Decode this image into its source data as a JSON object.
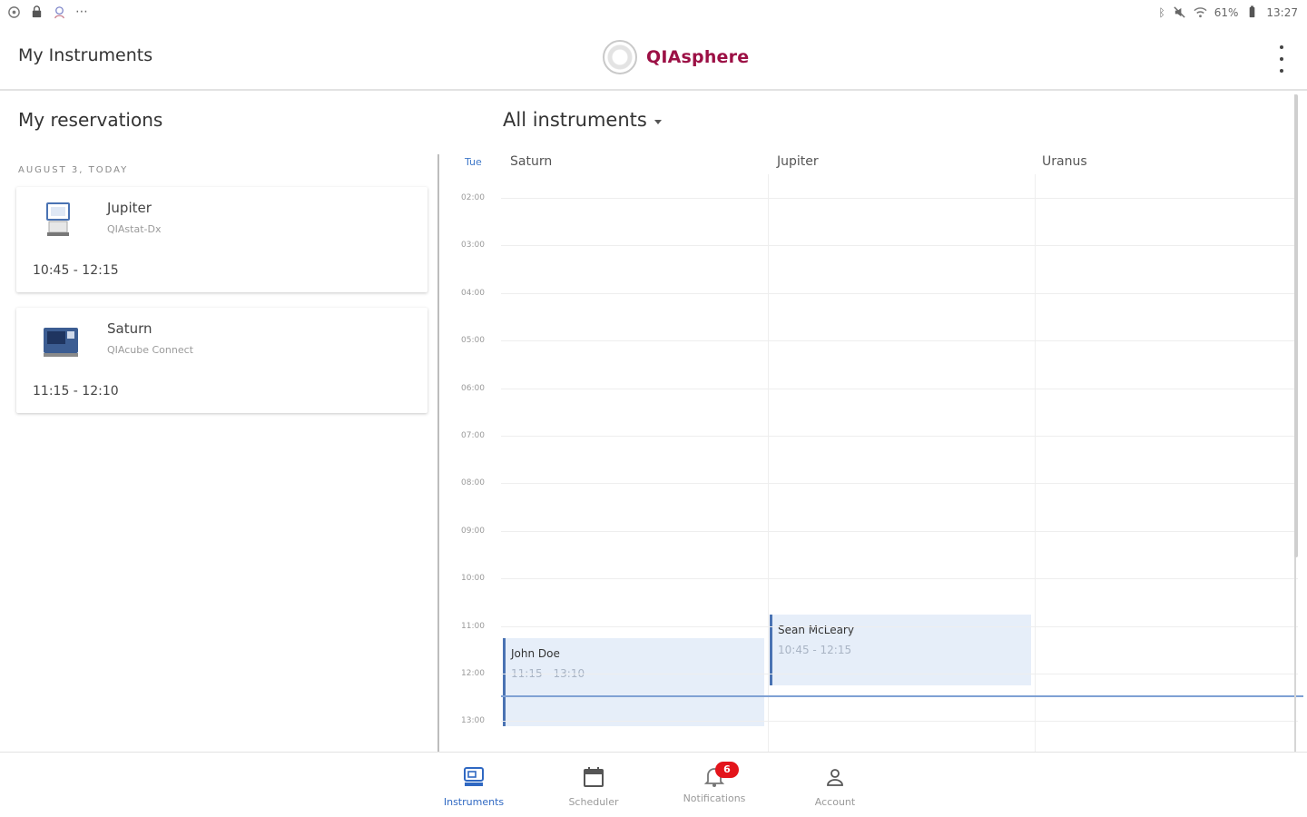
{
  "status_bar": {
    "left_icons": [
      "settings-circle-icon",
      "bag-icon",
      "account-circle-icon",
      "more-dots-icon"
    ],
    "right": {
      "battery_pct": "61%",
      "time": "13:27"
    },
    "right_icons": [
      "bluetooth-icon",
      "mute-icon",
      "wifi-icon",
      "battery-icon"
    ]
  },
  "app_bar": {
    "title": "My Instruments",
    "brand_name": "QIAsphere",
    "colors": {
      "brand": "#9c1045"
    }
  },
  "left_panel": {
    "title": "My reservations",
    "date_caption": "AUGUST 3, TODAY",
    "reservations": [
      {
        "name": "Jupiter",
        "model": "QIAstat-Dx",
        "time": "10:45 - 12:15",
        "icon": "analyzer-icon"
      },
      {
        "name": "Saturn",
        "model": "QIAcube Connect",
        "time": "11:15 - 12:10",
        "icon": "workstation-icon"
      }
    ]
  },
  "calendar": {
    "filter_label": "All instruments",
    "day_label": "Tue",
    "columns": [
      "Saturn",
      "Jupiter",
      "Uranus"
    ],
    "hours": [
      "02:00",
      "03:00",
      "04:00",
      "05:00",
      "06:00",
      "07:00",
      "08:00",
      "09:00",
      "10:00",
      "11:00",
      "12:00",
      "13:00"
    ],
    "current_time": "12:27",
    "events": [
      {
        "column": "Saturn",
        "name": "John Doe",
        "time": "11:15 - 13:10"
      },
      {
        "column": "Jupiter",
        "name": "Sean McLeary",
        "time": "10:45 - 12:15"
      }
    ],
    "colors": {
      "event_bg": "#e6eef9",
      "event_border": "#4a73b3",
      "now_line": "#7fa1d4"
    }
  },
  "bottom_nav": {
    "items": [
      {
        "label": "Instruments",
        "icon": "instruments-icon",
        "active": true
      },
      {
        "label": "Scheduler",
        "icon": "calendar-icon",
        "active": false
      },
      {
        "label": "Notifications",
        "icon": "bell-icon",
        "active": false,
        "badge": "6"
      },
      {
        "label": "Account",
        "icon": "person-icon",
        "active": false
      }
    ],
    "colors": {
      "active": "#2f68c2",
      "badge": "#e3141b"
    }
  }
}
